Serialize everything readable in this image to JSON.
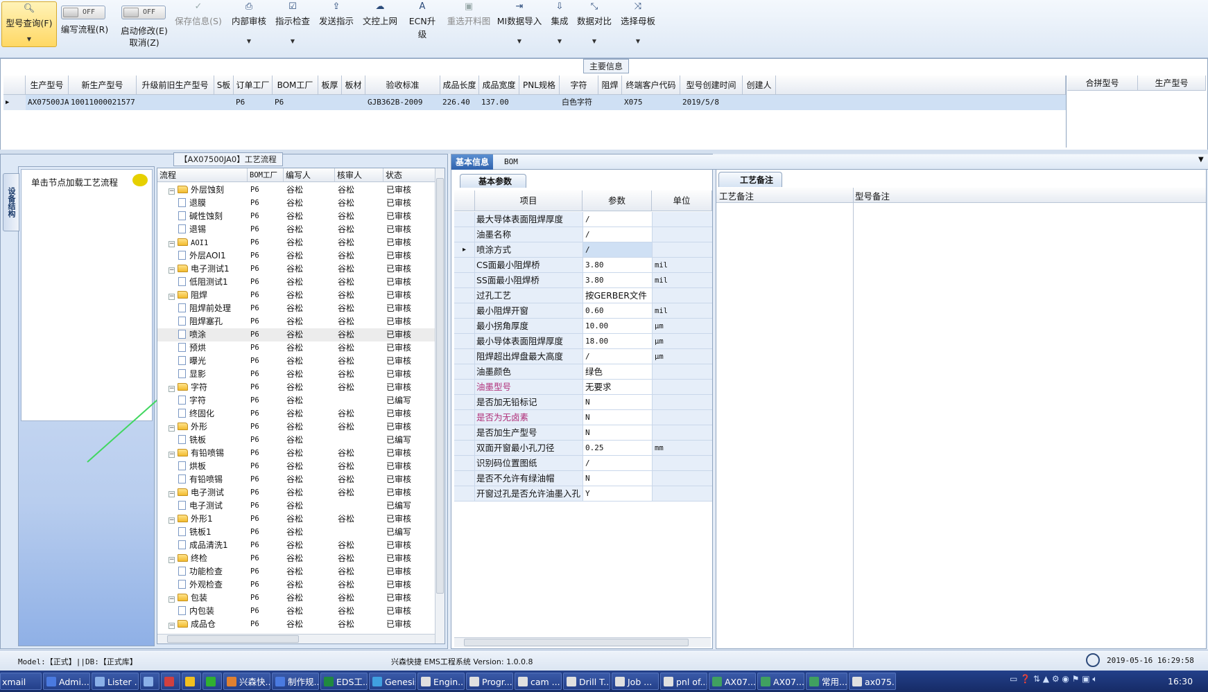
{
  "toolbar": {
    "query": "型号查询(F)",
    "write_flow_toggle": "OFF",
    "write_flow": "编写流程(R)",
    "start_edit_toggle": "OFF",
    "start_edit": "启动修改(E)",
    "cancel": "取消(Z)",
    "save": "保存信息(S)",
    "internal_review": "内部审核",
    "instruction_check": "指示检查",
    "send_instruction": "发送指示",
    "upload_doc": "文控上网",
    "ecn_upgrade": "ECN升级",
    "reselect_cut": "重选开料图",
    "mi_import": "MI数据导入",
    "integrate": "集成",
    "data_compare": "数据对比",
    "select_mother": "选择母板"
  },
  "main_info": {
    "title": "主要信息",
    "columns": [
      "生产型号",
      "新生产型号",
      "升级前旧生产型号",
      "S板",
      "订单工厂",
      "BOM工厂",
      "板厚",
      "板材",
      "验收标准",
      "成品长度",
      "成品宽度",
      "PNL规格",
      "字符",
      "阻焊",
      "终端客户代码",
      "型号创建时间",
      "创建人"
    ],
    "row": [
      "AX07500JA0",
      "10011000021577",
      "",
      "",
      "P6",
      "P6",
      "",
      "",
      "GJB362B-2009",
      "226.40",
      "137.00",
      "",
      "白色字符",
      "",
      "X075",
      "2019/5/8",
      ""
    ],
    "side_columns": [
      "合拼型号",
      "生产型号"
    ]
  },
  "flow_panel": {
    "title": "【AX07500JA0】工艺流程",
    "side_tab": "设备结构",
    "node_hint": "单击节点加载工艺流程",
    "columns": [
      "流程",
      "BOM工厂",
      "编写人",
      "核审人",
      "状态"
    ],
    "rows": [
      {
        "name": "外层蚀刻",
        "level": 0,
        "bom": "P6",
        "writer": "谷松",
        "reviewer": "谷松",
        "status": "已审核"
      },
      {
        "name": "退膜",
        "level": 1,
        "bom": "P6",
        "writer": "谷松",
        "reviewer": "谷松",
        "status": "已审核"
      },
      {
        "name": "碱性蚀刻",
        "level": 1,
        "bom": "P6",
        "writer": "谷松",
        "reviewer": "谷松",
        "status": "已审核"
      },
      {
        "name": "退锡",
        "level": 1,
        "bom": "P6",
        "writer": "谷松",
        "reviewer": "谷松",
        "status": "已审核"
      },
      {
        "name": "AOI1",
        "level": 0,
        "bom": "P6",
        "writer": "谷松",
        "reviewer": "谷松",
        "status": "已审核"
      },
      {
        "name": "外层AOI1",
        "level": 1,
        "bom": "P6",
        "writer": "谷松",
        "reviewer": "谷松",
        "status": "已审核"
      },
      {
        "name": "电子测试1",
        "level": 0,
        "bom": "P6",
        "writer": "谷松",
        "reviewer": "谷松",
        "status": "已审核"
      },
      {
        "name": "低阻测试1",
        "level": 1,
        "bom": "P6",
        "writer": "谷松",
        "reviewer": "谷松",
        "status": "已审核"
      },
      {
        "name": "阻焊",
        "level": 0,
        "bom": "P6",
        "writer": "谷松",
        "reviewer": "谷松",
        "status": "已审核"
      },
      {
        "name": "阻焊前处理",
        "level": 1,
        "bom": "P6",
        "writer": "谷松",
        "reviewer": "谷松",
        "status": "已审核"
      },
      {
        "name": "阻焊塞孔",
        "level": 1,
        "bom": "P6",
        "writer": "谷松",
        "reviewer": "谷松",
        "status": "已审核"
      },
      {
        "name": "喷涂",
        "level": 1,
        "bom": "P6",
        "writer": "谷松",
        "reviewer": "谷松",
        "status": "已审核"
      },
      {
        "name": "预烘",
        "level": 1,
        "bom": "P6",
        "writer": "谷松",
        "reviewer": "谷松",
        "status": "已审核"
      },
      {
        "name": "曝光",
        "level": 1,
        "bom": "P6",
        "writer": "谷松",
        "reviewer": "谷松",
        "status": "已审核"
      },
      {
        "name": "显影",
        "level": 1,
        "bom": "P6",
        "writer": "谷松",
        "reviewer": "谷松",
        "status": "已审核"
      },
      {
        "name": "字符",
        "level": 0,
        "bom": "P6",
        "writer": "谷松",
        "reviewer": "谷松",
        "status": "已审核"
      },
      {
        "name": "字符",
        "level": 1,
        "bom": "P6",
        "writer": "谷松",
        "reviewer": "",
        "status": "已编写"
      },
      {
        "name": "终固化",
        "level": 1,
        "bom": "P6",
        "writer": "谷松",
        "reviewer": "谷松",
        "status": "已审核"
      },
      {
        "name": "外形",
        "level": 0,
        "bom": "P6",
        "writer": "谷松",
        "reviewer": "谷松",
        "status": "已审核"
      },
      {
        "name": "铣板",
        "level": 1,
        "bom": "P6",
        "writer": "谷松",
        "reviewer": "",
        "status": "已编写"
      },
      {
        "name": "有铅喷锡",
        "level": 0,
        "bom": "P6",
        "writer": "谷松",
        "reviewer": "谷松",
        "status": "已审核"
      },
      {
        "name": "烘板",
        "level": 1,
        "bom": "P6",
        "writer": "谷松",
        "reviewer": "谷松",
        "status": "已审核"
      },
      {
        "name": "有铅喷锡",
        "level": 1,
        "bom": "P6",
        "writer": "谷松",
        "reviewer": "谷松",
        "status": "已审核"
      },
      {
        "name": "电子测试",
        "level": 0,
        "bom": "P6",
        "writer": "谷松",
        "reviewer": "谷松",
        "status": "已审核"
      },
      {
        "name": "电子测试",
        "level": 1,
        "bom": "P6",
        "writer": "谷松",
        "reviewer": "",
        "status": "已编写"
      },
      {
        "name": "外形1",
        "level": 0,
        "bom": "P6",
        "writer": "谷松",
        "reviewer": "谷松",
        "status": "已审核"
      },
      {
        "name": "铣板1",
        "level": 1,
        "bom": "P6",
        "writer": "谷松",
        "reviewer": "",
        "status": "已编写"
      },
      {
        "name": "成品清洗1",
        "level": 1,
        "bom": "P6",
        "writer": "谷松",
        "reviewer": "谷松",
        "status": "已审核"
      },
      {
        "name": "终检",
        "level": 0,
        "bom": "P6",
        "writer": "谷松",
        "reviewer": "谷松",
        "status": "已审核"
      },
      {
        "name": "功能检查",
        "level": 1,
        "bom": "P6",
        "writer": "谷松",
        "reviewer": "谷松",
        "status": "已审核"
      },
      {
        "name": "外观检查",
        "level": 1,
        "bom": "P6",
        "writer": "谷松",
        "reviewer": "谷松",
        "status": "已审核"
      },
      {
        "name": "包装",
        "level": 0,
        "bom": "P6",
        "writer": "谷松",
        "reviewer": "谷松",
        "status": "已审核"
      },
      {
        "name": "内包装",
        "level": 1,
        "bom": "P6",
        "writer": "谷松",
        "reviewer": "谷松",
        "status": "已审核"
      },
      {
        "name": "成品仓",
        "level": 0,
        "bom": "P6",
        "writer": "谷松",
        "reviewer": "谷松",
        "status": "已审核"
      }
    ]
  },
  "basic_panel": {
    "tab_basic": "基本信息",
    "tab_bom": "BOM",
    "subtab": "基本参数",
    "columns": [
      "项目",
      "参数",
      "单位"
    ],
    "rows": [
      {
        "item": "最大导体表面阻焊厚度",
        "value": "/",
        "unit": "",
        "color": "#111"
      },
      {
        "item": "油墨名称",
        "value": "/",
        "unit": "",
        "color": "#111"
      },
      {
        "item": "喷涂方式",
        "value": "/",
        "unit": "",
        "color": "#111"
      },
      {
        "item": "CS面最小阻焊桥",
        "value": "3.80",
        "unit": "mil",
        "color": "#111"
      },
      {
        "item": "SS面最小阻焊桥",
        "value": "3.80",
        "unit": "mil",
        "color": "#111"
      },
      {
        "item": "过孔工艺",
        "value": "按GERBER文件",
        "unit": "",
        "color": "#111"
      },
      {
        "item": "最小阻焊开窗",
        "value": "0.60",
        "unit": "mil",
        "color": "#111"
      },
      {
        "item": "最小拐角厚度",
        "value": "10.00",
        "unit": "μm",
        "color": "#111"
      },
      {
        "item": "最小导体表面阻焊厚度",
        "value": "18.00",
        "unit": "μm",
        "color": "#111"
      },
      {
        "item": "阻焊超出焊盘最大高度",
        "value": "/",
        "unit": "μm",
        "color": "#111"
      },
      {
        "item": "油墨颜色",
        "value": "绿色",
        "unit": "",
        "color": "#111"
      },
      {
        "item": "油墨型号",
        "value": "无要求",
        "unit": "",
        "color": "#b0307a"
      },
      {
        "item": "是否加无铅标记",
        "value": "N",
        "unit": "",
        "color": "#111"
      },
      {
        "item": "是否为无卤素",
        "value": "N",
        "unit": "",
        "color": "#b0307a"
      },
      {
        "item": "是否加生产型号",
        "value": "N",
        "unit": "",
        "color": "#111"
      },
      {
        "item": "双面开窗最小孔刀径",
        "value": "0.25",
        "unit": "mm",
        "color": "#111"
      },
      {
        "item": "识别码位置图纸",
        "value": "/",
        "unit": "",
        "color": "#111"
      },
      {
        "item": "是否不允许有绿油帽",
        "value": "N",
        "unit": "",
        "color": "#111"
      },
      {
        "item": "开窗过孔是否允许油墨入孔",
        "value": "Y",
        "unit": "",
        "color": "#111"
      }
    ]
  },
  "remark_panel": {
    "tab": "工艺备注",
    "col_process": "工艺备注",
    "col_model": "型号备注"
  },
  "status_bar": {
    "model": "Model:【正式】||DB:【正式库】",
    "system": "兴森快捷 EMS工程系统 Version: 1.0.0.8",
    "datetime": "2019-05-16 16:29:58"
  },
  "taskbar": {
    "items": [
      "xmail",
      "Admi...",
      "Lister ...",
      "",
      "",
      "",
      "",
      "兴森快...",
      "制作规...",
      "EDS工...",
      "Genesis",
      "Engin...",
      "Progr...",
      "cam ...",
      "Drill T...",
      "Job ...",
      "pnl of...",
      "AX07...",
      "AX07...",
      "常用...",
      "ax075..."
    ],
    "clock": "16:30"
  }
}
